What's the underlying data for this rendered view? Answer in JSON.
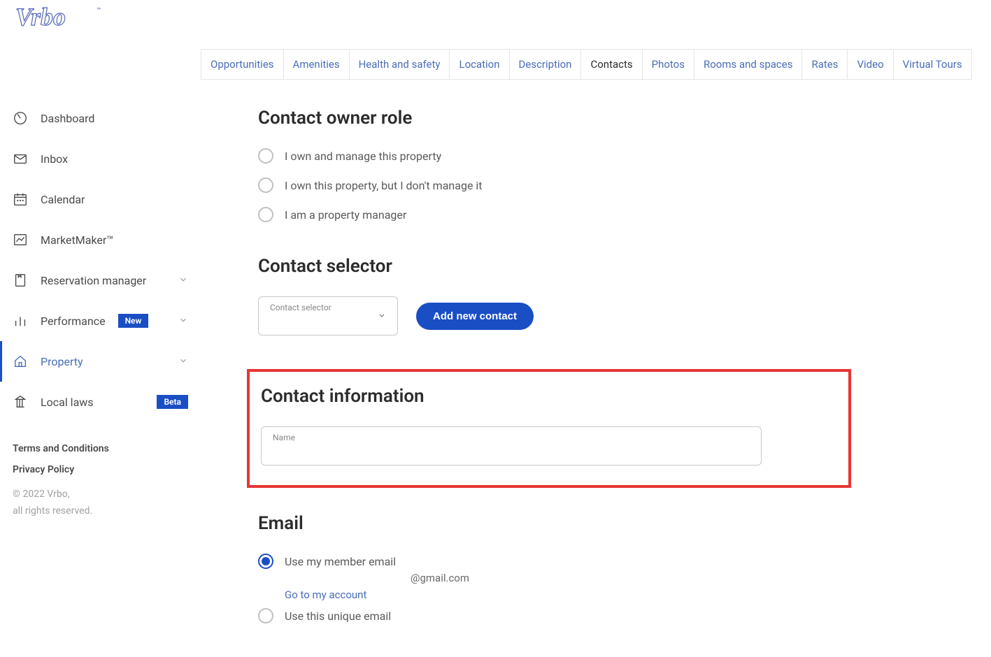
{
  "logo": "Vrbo",
  "sidebar": {
    "items": [
      {
        "label": "Dashboard",
        "icon": "dashboard"
      },
      {
        "label": "Inbox",
        "icon": "inbox"
      },
      {
        "label": "Calendar",
        "icon": "calendar"
      },
      {
        "label": "MarketMaker™",
        "icon": "chart"
      },
      {
        "label": "Reservation manager",
        "icon": "reservation",
        "chevron": true
      },
      {
        "label": "Performance",
        "icon": "bars",
        "badge": "New",
        "chevron": true
      },
      {
        "label": "Property",
        "icon": "home",
        "chevron": true,
        "active": true
      },
      {
        "label": "Local laws",
        "icon": "laws",
        "badge_right": "Beta"
      }
    ],
    "footer": {
      "terms": "Terms and Conditions",
      "privacy": "Privacy Policy",
      "copyright1": "© 2022 Vrbo,",
      "copyright2": "all rights reserved."
    }
  },
  "tabs": [
    "Opportunities",
    "Amenities",
    "Health and safety",
    "Location",
    "Description",
    "Contacts",
    "Photos",
    "Rooms and spaces",
    "Rates",
    "Video",
    "Virtual Tours"
  ],
  "active_tab": "Contacts",
  "sections": {
    "owner_role": {
      "title": "Contact owner role",
      "options": [
        "I own and manage this property",
        "I own this property, but I don't manage it",
        "I am a property manager"
      ]
    },
    "contact_selector": {
      "title": "Contact selector",
      "select_label": "Contact selector",
      "button": "Add new contact"
    },
    "contact_info": {
      "title": "Contact information",
      "name_label": "Name"
    },
    "email": {
      "title": "Email",
      "option1": "Use my member email",
      "email_suffix": "@gmail.com",
      "account_link": "Go to my account",
      "option2": "Use this unique email"
    }
  }
}
